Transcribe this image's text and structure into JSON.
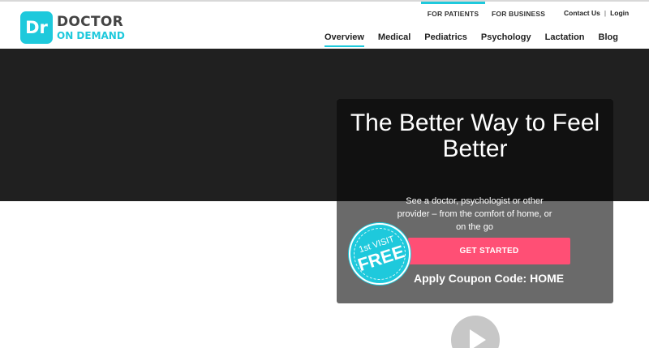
{
  "brand": {
    "mark": "Dr",
    "line1": "DOCTOR",
    "line2": "ON DEMAND",
    "accent_color": "#1ec9dc"
  },
  "audience_tabs": [
    {
      "label": "FOR PATIENTS",
      "active": true
    },
    {
      "label": "FOR BUSINESS",
      "active": false
    }
  ],
  "account": {
    "contact_label": "Contact Us",
    "separator": "|",
    "login_label": "Login"
  },
  "nav": [
    {
      "label": "Overview",
      "active": true
    },
    {
      "label": "Medical"
    },
    {
      "label": "Pediatrics"
    },
    {
      "label": "Psychology"
    },
    {
      "label": "Lactation"
    },
    {
      "label": "Blog"
    }
  ],
  "hero": {
    "title": "The Better Way to Feel Better",
    "subtitle": "See a doctor, psychologist or other provider – from the comfort of home, or on the go",
    "cta_label": "GET STARTED",
    "cta_color": "#ff4f75",
    "coupon": "Apply Coupon Code: HOME"
  },
  "badge": {
    "line1": "1st VISIT",
    "line2": "FREE"
  },
  "video": {
    "icon": "play-icon"
  }
}
